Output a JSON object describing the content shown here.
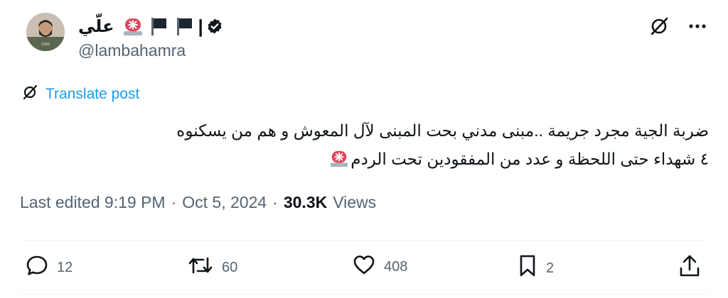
{
  "author": {
    "display_name": "علّي",
    "handle": "@lambahamra",
    "name_icons": [
      "siren-emoji",
      "black-flag-emoji",
      "black-flag-emoji",
      "verified-badge-icon"
    ],
    "separator": "|"
  },
  "translate": {
    "label": "Translate post",
    "icon": "translate-icon"
  },
  "tweet": {
    "line1": "ضربة الجية مجرد جريمة ..مبنى مدني بحت المبنى لآل المعوش و  هم من يسكنوه",
    "line2": "٤ شهداء حتى اللحظة و عدد من المفقودين تحت الردم"
  },
  "meta": {
    "edited": "Last edited 9:19 PM",
    "separator": "·",
    "date": "Oct 5, 2024",
    "views_count": "30.3K",
    "views_label": "Views"
  },
  "actions": {
    "replies": "12",
    "reposts": "60",
    "likes": "408",
    "bookmarks": "2"
  },
  "colors": {
    "link": "#1d9bf0",
    "secondary_text": "#536471",
    "primary_text": "#0f1419",
    "divider": "#eff3f4"
  }
}
